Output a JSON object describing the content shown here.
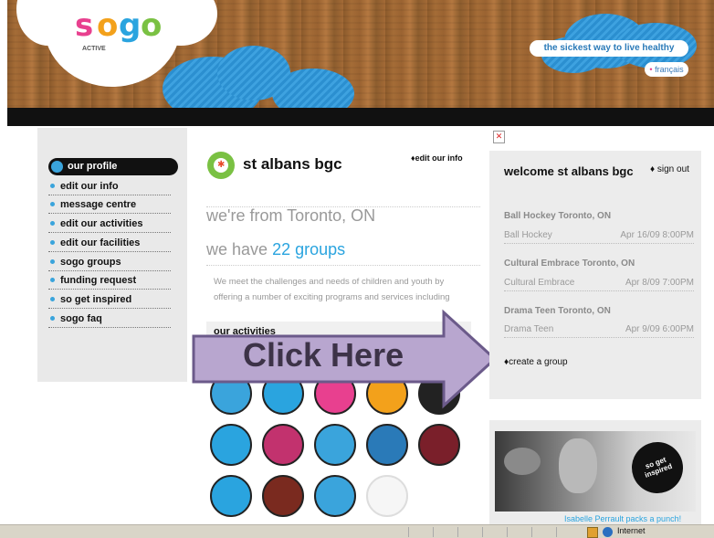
{
  "header": {
    "logo": {
      "letters": [
        "s",
        "o",
        "g",
        "o"
      ],
      "sub": "ACTIVE",
      "colors": [
        "#e8408f",
        "#f3a11b",
        "#2aa4df",
        "#7ac143"
      ]
    },
    "tagline": "the sickest way to live healthy",
    "language": "français"
  },
  "sidebar": {
    "active": "our profile",
    "items": [
      "edit our info",
      "message centre",
      "edit our activities",
      "edit our facilities",
      "sogo groups",
      "funding request",
      "so get inspired",
      "sogo faq"
    ]
  },
  "profile": {
    "name": "st albans bgc",
    "edit_link": "edit our info",
    "location": "we're from Toronto, ON",
    "groups_prefix": "we have",
    "groups_count": "22 groups",
    "description_line1": "We meet the challenges and needs of children and youth by",
    "description_line2": "offering a number of exciting programs and services including",
    "activities_heading": "our activities"
  },
  "callout": {
    "label": "Click Here"
  },
  "right": {
    "welcome": "welcome st albans bgc",
    "signout": "sign out",
    "events": [
      {
        "title": "Ball Hockey Toronto, ON",
        "name": "Ball Hockey",
        "date": "Apr 16/09 8:00PM"
      },
      {
        "title": "Cultural Embrace Toronto, ON",
        "name": "Cultural Embrace",
        "date": "Apr 8/09 7:00PM"
      },
      {
        "title": "Drama Teen Toronto, ON",
        "name": "Drama Teen",
        "date": "Apr 9/09 6:00PM"
      }
    ],
    "create_group": "create a group",
    "promo": {
      "badge": "so get inspired",
      "caption": "Isabelle Perrault packs a punch!"
    }
  },
  "statusbar": {
    "zone": "Internet"
  },
  "avatar_colors": [
    "#3aa4dc",
    "#e8408f",
    "#2aa4df",
    "#7ac143",
    "#e84b2b",
    "#f3a11b",
    "#222222"
  ]
}
